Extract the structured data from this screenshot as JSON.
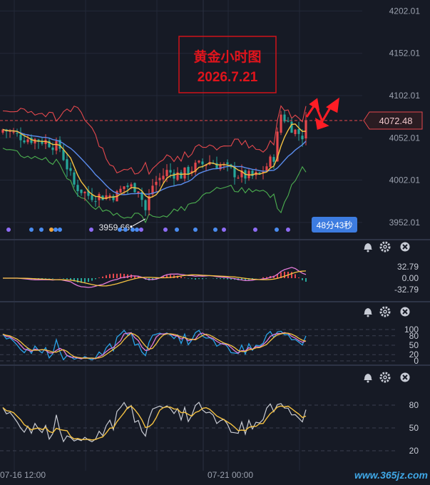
{
  "chart_data": [
    {
      "type": "candlestick",
      "panel": "main",
      "title": "黄金小时图",
      "subtitle": "2026.7.21",
      "y_ticks": [
        "4202.01",
        "4152.01",
        "4102.01",
        "4052.01",
        "4002.01",
        "3952.01"
      ],
      "y_tick_values": [
        4202.01,
        4152.01,
        4102.01,
        4052.01,
        4002.01,
        3952.01
      ],
      "ylim": [
        3935,
        4215
      ],
      "last_price": "4072.48",
      "last_price_value": 4072.48,
      "low_label": "3959.66",
      "low_value": 3959.66,
      "countdown": "48分43秒",
      "colors": {
        "up": "#e5484d",
        "down": "#26a69a",
        "upper_band": "#e5484d",
        "lower_band": "#4caf50",
        "ma_fast": "#f5c242",
        "ma_slow": "#5b8def"
      }
    },
    {
      "type": "line",
      "panel": "macd",
      "y_ticks": [
        "32.79",
        "0.00",
        "-32.79"
      ],
      "y_tick_values": [
        32.79,
        0,
        -32.79
      ]
    },
    {
      "type": "line",
      "panel": "kdj",
      "y_ticks": [
        "100",
        "80",
        "50",
        "20",
        "0"
      ],
      "y_tick_values": [
        100,
        80,
        50,
        20,
        0
      ]
    },
    {
      "type": "line",
      "panel": "rsi",
      "y_ticks": [
        "80",
        "50",
        "20"
      ],
      "y_tick_values": [
        80,
        50,
        20
      ]
    }
  ],
  "x_labels": [
    "07-16 12:00",
    "07-21 00:00"
  ],
  "watermark": "www.365jz.com",
  "panel_icons": [
    "bell-icon",
    "gear-icon",
    "close-icon"
  ]
}
